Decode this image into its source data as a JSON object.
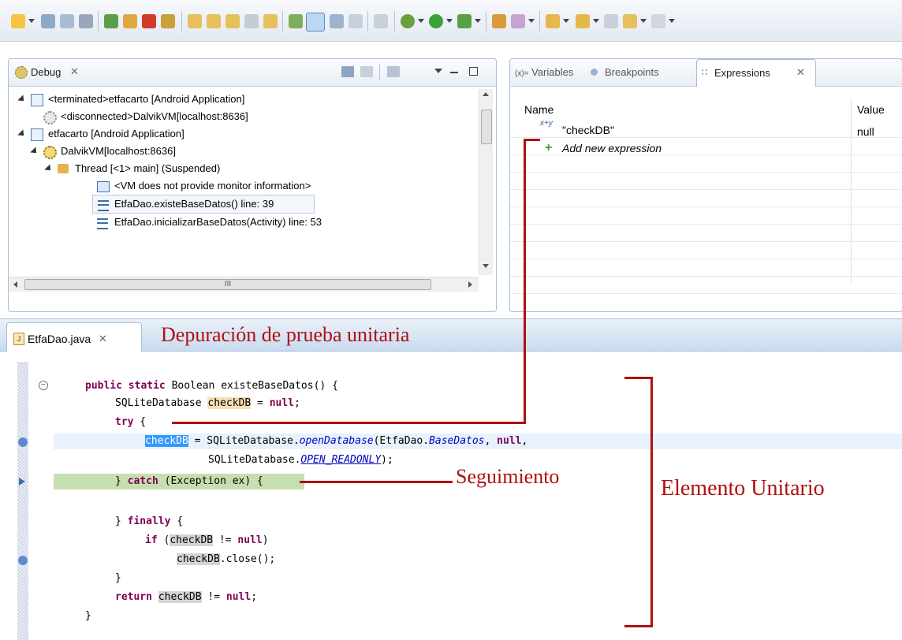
{
  "debug_panel": {
    "tab_label": "Debug",
    "close_glyph": "✕",
    "tree": [
      {
        "label": "<terminated>etfacarto [Android Application]",
        "icon": "app-icon"
      },
      {
        "label": "<disconnected>DalvikVM[localhost:8636]",
        "icon": "vm-icon"
      },
      {
        "label": "etfacarto [Android Application]",
        "icon": "app-icon"
      },
      {
        "label": "DalvikVM[localhost:8636]",
        "icon": "vm-icon"
      },
      {
        "label": "Thread [<1> main] (Suspended)",
        "icon": "thread-icon"
      },
      {
        "label": "<VM does not provide monitor information>",
        "icon": "monitor-icon"
      },
      {
        "label": "EtfaDao.existeBaseDatos() line: 39",
        "icon": "stack-frame-icon"
      },
      {
        "label": "EtfaDao.inicializarBaseDatos(Activity) line: 53",
        "icon": "stack-frame-icon"
      }
    ],
    "hscroll_glyph": "III"
  },
  "expressions_panel": {
    "tabs": [
      {
        "label": "Variables",
        "prefix": "(x)=",
        "active": false
      },
      {
        "label": "Breakpoints",
        "active": false
      },
      {
        "label": "Expressions",
        "active": true
      }
    ],
    "close_glyph": "✕",
    "columns": {
      "name": "Name",
      "value": "Value"
    },
    "rows": [
      {
        "name": "\"checkDB\"",
        "value": "null",
        "icon_text": "x+y"
      },
      {
        "name": "Add new expression",
        "value": ""
      }
    ]
  },
  "editor": {
    "tab_label": "EtfaDao.java",
    "close_glyph": "✕",
    "code": {
      "l1_a": "public static",
      "l1_b": " Boolean existeBaseDatos() {",
      "l2_a": "SQLiteDatabase ",
      "l2_b": "checkDB",
      "l2_c": " = ",
      "l2_d": "null",
      "l2_e": ";",
      "l3": "try",
      "l3_b": " {",
      "l4_a": "checkDB",
      "l4_b": " = SQLiteDatabase.",
      "l4_c": "openDatabase",
      "l4_d": "(EtfaDao.",
      "l4_e": "BaseDatos",
      "l4_f": ", ",
      "l4_g": "null",
      "l4_h": ",",
      "l5_a": "SQLiteDatabase.",
      "l5_b": "OPEN_READONLY",
      "l5_c": ");",
      "l6_a": "} ",
      "l6_b": "catch",
      "l6_c": " (Exception ex) {",
      "l7_a": "} ",
      "l7_b": "finally",
      "l7_c": " {",
      "l8_a": "if",
      "l8_b": " (",
      "l8_c": "checkDB",
      "l8_d": " != ",
      "l8_e": "null",
      "l8_f": ")",
      "l9_a": "checkDB",
      "l9_b": ".close();",
      "l10": "}",
      "l11_a": "return",
      "l11_b": " ",
      "l11_c": "checkDB",
      "l11_d": " != ",
      "l11_e": "null",
      "l11_f": ";",
      "l12": "}"
    }
  },
  "annotations": {
    "title": "Depuración de prueba unitaria",
    "tracking": "Seguimiento",
    "unit_element": "Elemento Unitario"
  },
  "colors": {
    "annotation_red": "#b01010",
    "debug_line_highlight": "#c6dfb0",
    "current_line_highlight": "#e8f2fe",
    "keyword": "#7f0055"
  }
}
